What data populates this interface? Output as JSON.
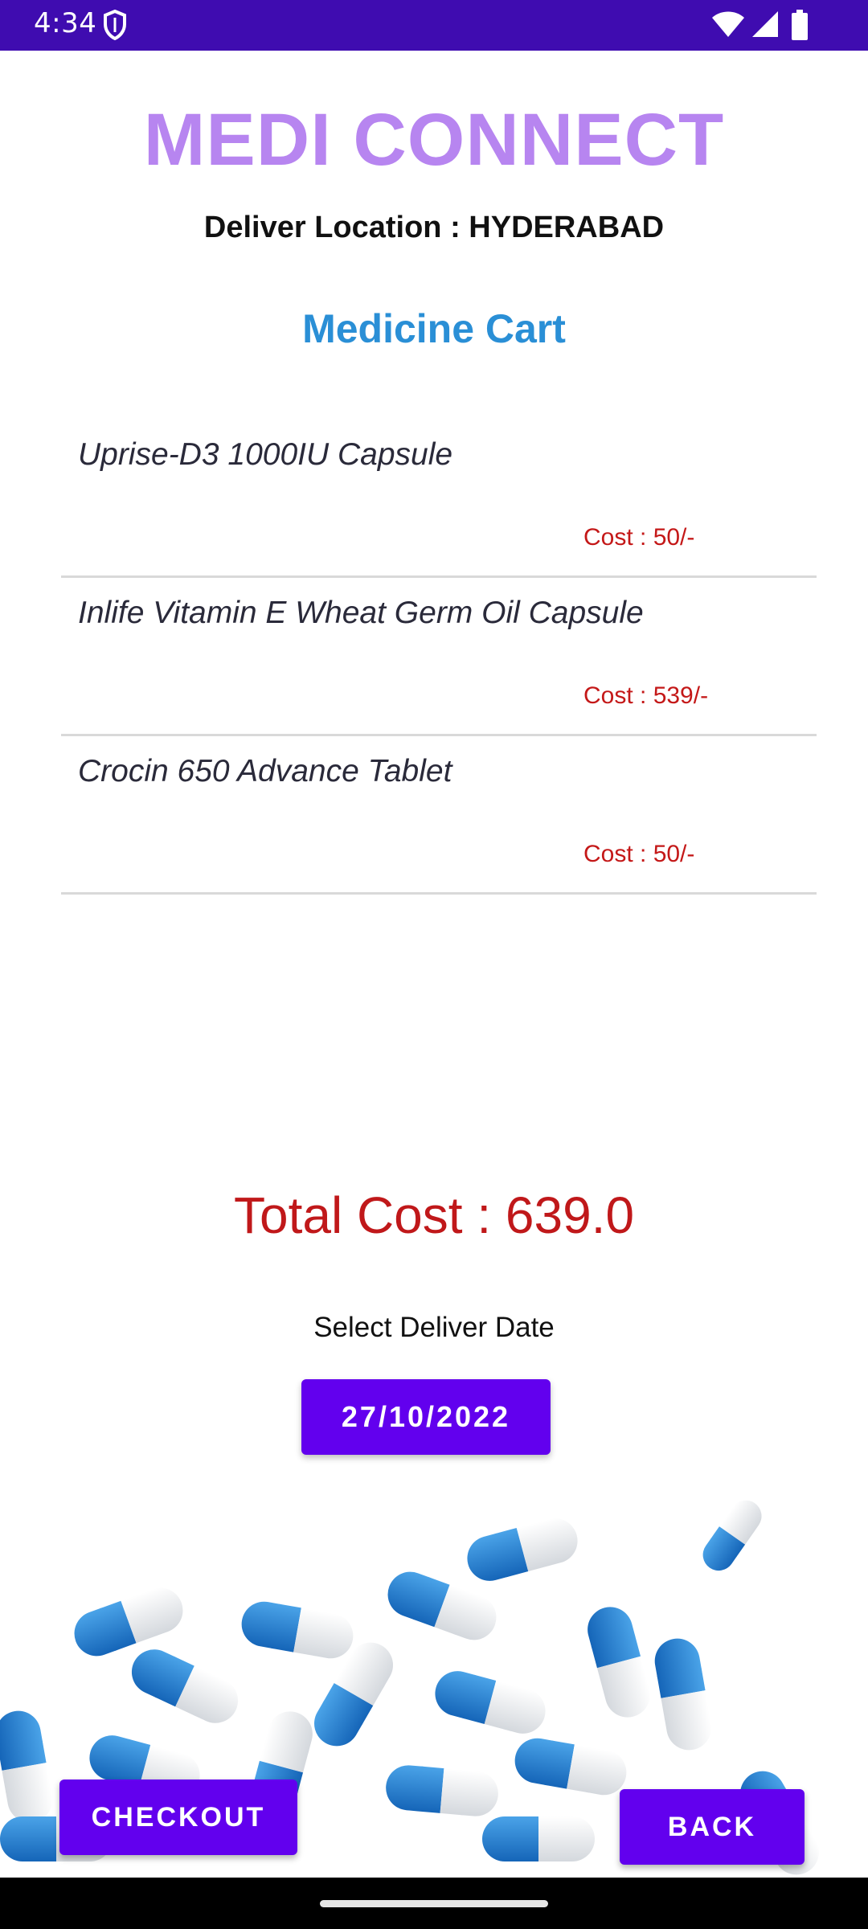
{
  "status_bar": {
    "time": "4:34",
    "icons": [
      "shield-icon",
      "wifi-icon",
      "signal-icon",
      "battery-icon"
    ],
    "background": "#3f0cb0"
  },
  "header": {
    "app_title": "MEDI CONNECT",
    "deliver_location": "Deliver Location : HYDERABAD",
    "cart_heading": "Medicine Cart"
  },
  "cart": {
    "items": [
      {
        "name": "Uprise-D3 1000IU Capsule",
        "cost": "Cost : 50/-"
      },
      {
        "name": "Inlife Vitamin E Wheat Germ Oil Capsule",
        "cost": "Cost : 539/-"
      },
      {
        "name": "Crocin 650 Advance Tablet",
        "cost": "Cost : 50/-"
      }
    ]
  },
  "summary": {
    "total_cost": "Total Cost : 639.0",
    "select_date_label": "Select Deliver Date",
    "delivery_date": "27/10/2022"
  },
  "actions": {
    "checkout_label": "CHECKOUT",
    "back_label": "BACK"
  },
  "colors": {
    "accent": "#6200ee",
    "title": "#b785f0",
    "heading": "#2a8fd6",
    "cost": "#c41818"
  }
}
